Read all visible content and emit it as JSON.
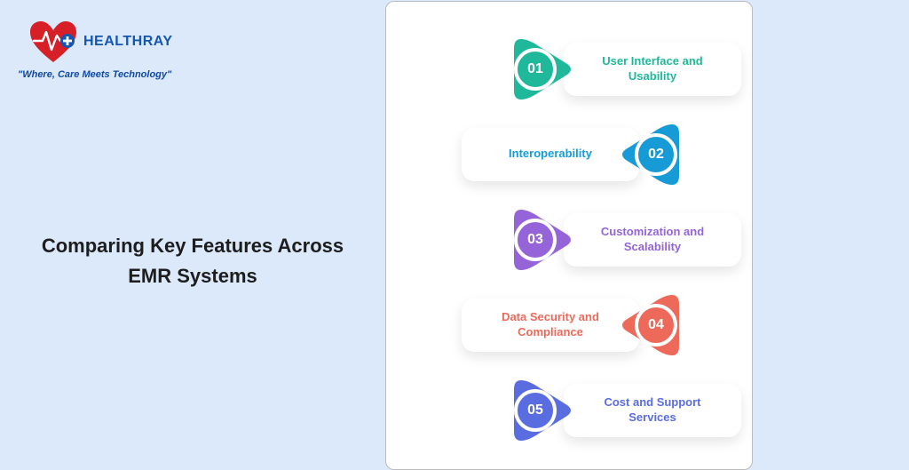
{
  "brand": "HEALTHRAY",
  "tagline": "\"Where, Care Meets Technology\"",
  "headline": "Comparing Key Features Across EMR Systems",
  "items": [
    {
      "num": "01",
      "label": "User Interface and Usability",
      "color": "#20b89a",
      "side": "l"
    },
    {
      "num": "02",
      "label": "Interoperability",
      "color": "#169bd7",
      "side": "r"
    },
    {
      "num": "03",
      "label": "Customization and Scalability",
      "color": "#9564d8",
      "side": "l"
    },
    {
      "num": "04",
      "label": "Data Security and Compliance",
      "color": "#ed6a5a",
      "side": "r"
    },
    {
      "num": "05",
      "label": "Cost and Support Services",
      "color": "#5a6de0",
      "side": "l"
    }
  ]
}
